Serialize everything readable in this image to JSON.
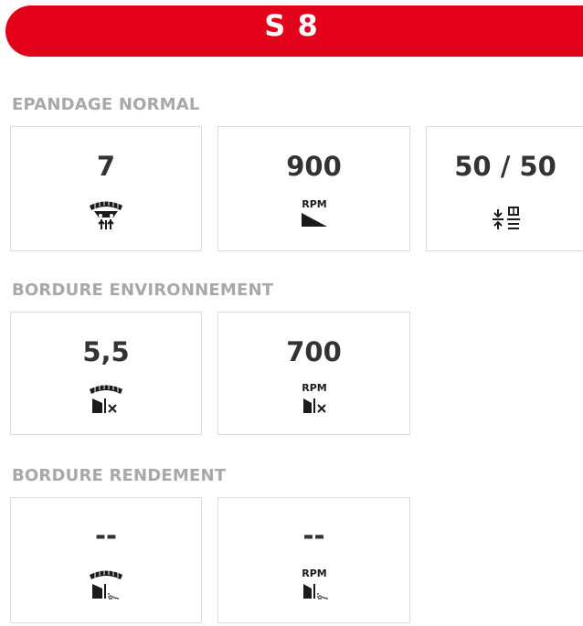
{
  "header": {
    "title": "S 8"
  },
  "sections": [
    {
      "title": "EPANDAGE NORMAL",
      "cards": [
        {
          "value": "7",
          "icon": "disc-spreading-position-icon"
        },
        {
          "value": "900",
          "icon": "rpm-ramp-icon",
          "icon_label": "RPM"
        },
        {
          "value": "50 / 50",
          "icon": "flow-distribution-icon"
        }
      ]
    },
    {
      "title": "BORDURE ENVIRONNEMENT",
      "cards": [
        {
          "value": "5,5",
          "icon": "disc-border-environment-icon"
        },
        {
          "value": "700",
          "icon": "rpm-border-environment-icon",
          "icon_label": "RPM"
        }
      ]
    },
    {
      "title": "BORDURE RENDEMENT",
      "cards": [
        {
          "value": "--",
          "icon": "disc-border-yield-icon"
        },
        {
          "value": "--",
          "icon": "rpm-border-yield-icon",
          "icon_label": "RPM"
        }
      ]
    }
  ],
  "colors": {
    "accent": "#e2001a",
    "section_title": "#a8a8a8",
    "value_text": "#333333",
    "card_border": "#dcdcdc",
    "icon": "#1a1a1a"
  }
}
